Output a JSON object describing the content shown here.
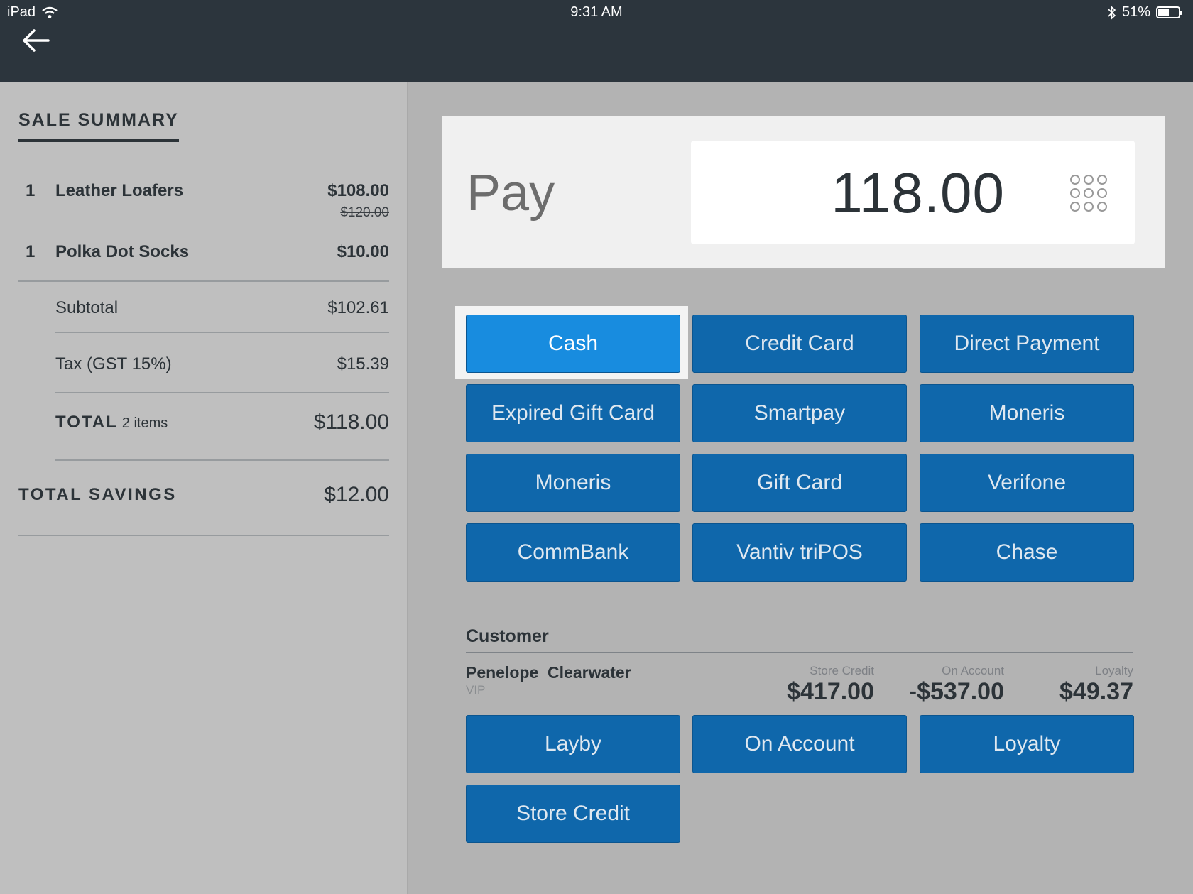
{
  "status_bar": {
    "device": "iPad",
    "time": "9:31 AM",
    "battery": "51%"
  },
  "summary": {
    "title": "SALE SUMMARY",
    "items": [
      {
        "qty": "1",
        "name": "Leather Loafers",
        "price": "$108.00",
        "original_price": "$120.00"
      },
      {
        "qty": "1",
        "name": "Polka Dot Socks",
        "price": "$10.00"
      }
    ],
    "subtotal_label": "Subtotal",
    "subtotal": "$102.61",
    "tax_label": "Tax (GST 15%)",
    "tax": "$15.39",
    "total_label": "TOTAL",
    "total_items": "2 items",
    "total": "$118.00",
    "savings_label": "TOTAL SAVINGS",
    "savings": "$12.00"
  },
  "pay": {
    "label": "Pay",
    "amount": "118.00"
  },
  "payment_methods": [
    "Cash",
    "Credit Card",
    "Direct Payment",
    "Expired Gift Card",
    "Smartpay",
    "Moneris",
    "Moneris",
    "Gift Card",
    "Verifone",
    "CommBank",
    "Vantiv triPOS",
    "Chase"
  ],
  "customer": {
    "title": "Customer",
    "name": "Penelope  Clearwater",
    "tag": "VIP",
    "store_credit_label": "Store Credit",
    "store_credit": "$417.00",
    "on_account_label": "On Account",
    "on_account": "-$537.00",
    "loyalty_label": "Loyalty",
    "loyalty": "$49.37",
    "actions": [
      "Layby",
      "On Account",
      "Loyalty",
      "Store Credit"
    ]
  },
  "colors": {
    "header": "#2c353d",
    "button": "#0f67ab",
    "button_active": "#188cdf"
  }
}
